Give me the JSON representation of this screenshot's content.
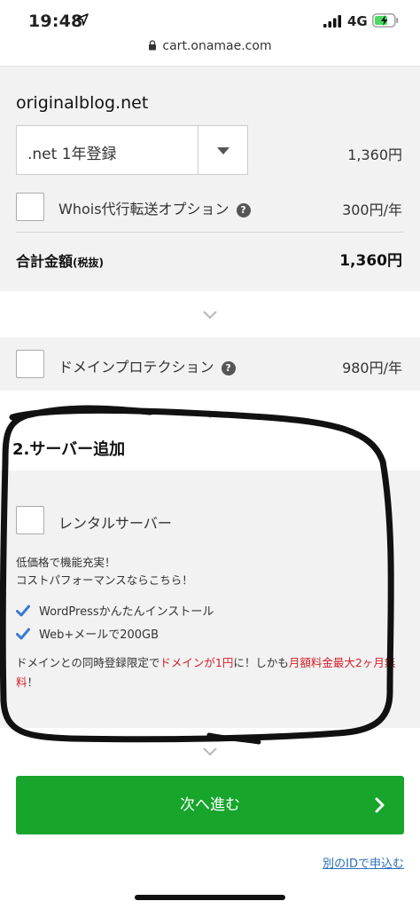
{
  "status_bar": {
    "time": "19:48",
    "network": "4G"
  },
  "url_bar": {
    "url": "cart.onamae.com"
  },
  "domain_panel": {
    "domain_name": "originalblog.net",
    "plan_select": ".net 1年登録",
    "plan_price": "1,360円",
    "whois_label": "Whois代行転送オプション",
    "whois_price": "300円/年",
    "total_label": "合計金額",
    "total_tax_note": "(税抜)",
    "total_value": "1,360円"
  },
  "protection": {
    "label": "ドメインプロテクション",
    "price": "980円/年"
  },
  "server_section": {
    "title": "2.サーバー追加",
    "rental_label": "レンタルサーバー",
    "desc_line1": "低価格で機能充実！",
    "desc_line2": "コストパフォーマンスならこちら！",
    "feature1": "WordPressかんたんインストール",
    "feature2": "Web+メールで200GB",
    "promo_part1": "ドメインとの同時登録限定で",
    "promo_red1": "ドメインが1円",
    "promo_part2": "に！しかも",
    "promo_red2": "月額料金最大2ヶ月無料",
    "promo_part3": "！"
  },
  "actions": {
    "next_label": "次へ進む",
    "alt_link": "別のIDで申込む"
  },
  "colors": {
    "accent_green": "#17a52c",
    "promo_red": "#d3202a",
    "link_blue": "#2a6ebb",
    "check_blue": "#3a78d8",
    "battery_green": "#4cd964"
  }
}
